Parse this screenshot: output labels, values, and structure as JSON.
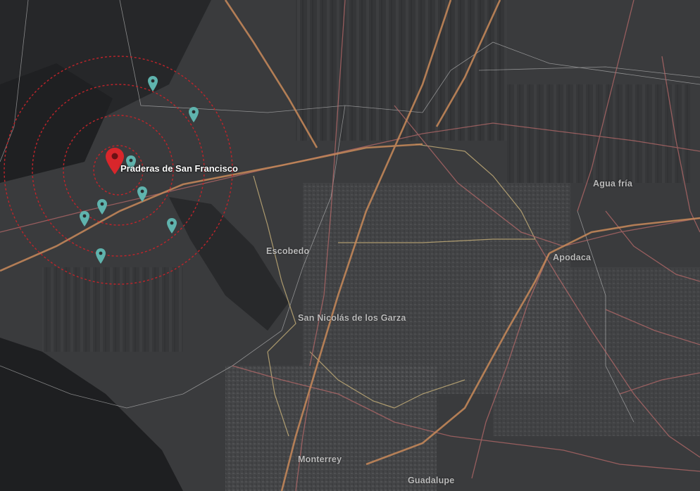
{
  "map": {
    "colors": {
      "ring": "#c0242a",
      "main_pin": "#d8262b",
      "secondary_pin": "#5fb3ad",
      "highway": "#c98a5a",
      "municipal_border": "#c9b27a",
      "road": "#b86a6a",
      "state_border": "#d8d8d8"
    },
    "main_location": {
      "label": "Praderas de San Francisco",
      "icon": "location-pin-icon"
    },
    "secondary_markers": {
      "count": 8,
      "icon": "location-pin-icon"
    },
    "places": [
      {
        "id": "escobedo",
        "label": "Escobedo"
      },
      {
        "id": "san-nicolas",
        "label": "San Nicolás de los Garza"
      },
      {
        "id": "apodaca",
        "label": "Apodaca"
      },
      {
        "id": "agua-fria",
        "label": "Agua fría"
      },
      {
        "id": "monterrey",
        "label": "Monterrey"
      },
      {
        "id": "guadalupe",
        "label": "Guadalupe"
      }
    ]
  }
}
